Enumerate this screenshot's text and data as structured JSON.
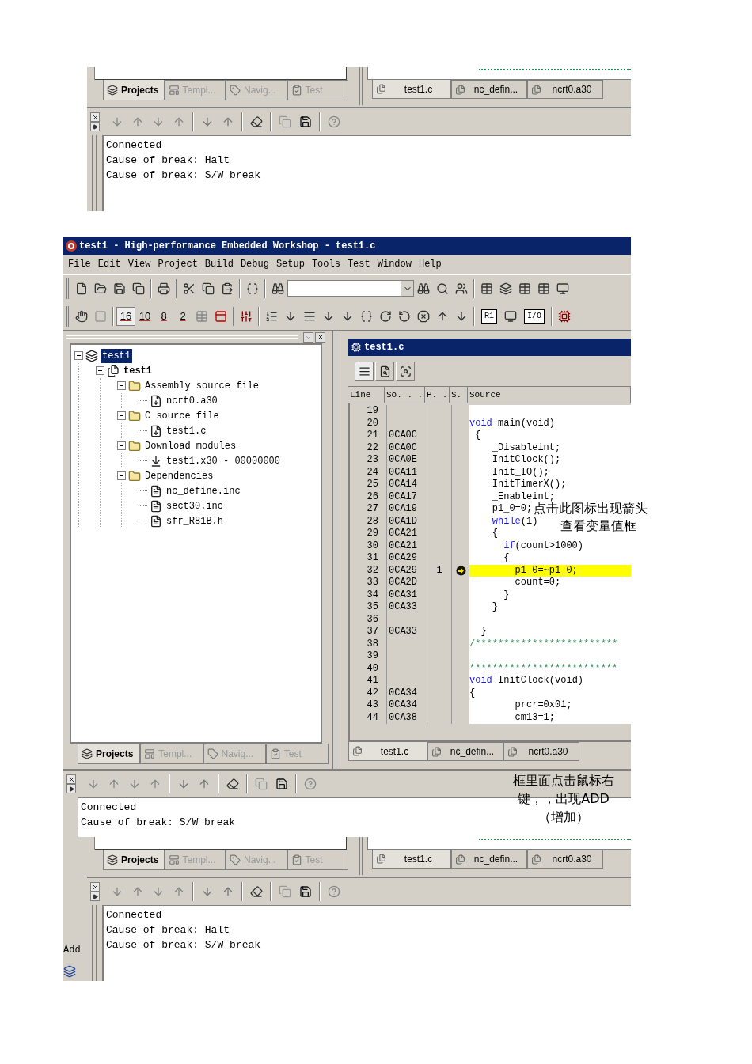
{
  "top_snippet": {
    "panel_tabs": [
      {
        "label": "Projects",
        "kind": "projects",
        "selected": true
      },
      {
        "label": "Templ...",
        "kind": "templates",
        "selected": false
      },
      {
        "label": "Navig...",
        "kind": "navigation",
        "selected": false
      },
      {
        "label": "Test",
        "kind": "test",
        "selected": false
      }
    ],
    "file_tabs": [
      {
        "label": "test1.c",
        "selected": true
      },
      {
        "label": "nc_defin...",
        "selected": false
      },
      {
        "label": "ncrt0.a30",
        "selected": false
      }
    ],
    "log": [
      "Connected",
      "Cause of break: Halt",
      "Cause of break: S/W break"
    ]
  },
  "window": {
    "title": "test1 - High-performance Embedded Workshop - test1.c",
    "menu": [
      "File",
      "Edit",
      "View",
      "Project",
      "Build",
      "Debug",
      "Setup",
      "Tools",
      "Test",
      "Window",
      "Help"
    ],
    "radix_buttons": [
      {
        "label": "16",
        "selected": true
      },
      {
        "label": "10",
        "selected": false
      },
      {
        "label": "8",
        "selected": false
      },
      {
        "label": "2",
        "selected": false
      }
    ],
    "view_buttons": [
      {
        "label": "R1"
      },
      {
        "label": "I/O"
      }
    ],
    "tree": [
      {
        "label": "test1",
        "kind": "workspace",
        "selected": true,
        "expanded": true,
        "children": [
          {
            "label": "test1",
            "kind": "project",
            "selected": false,
            "expanded": true,
            "children": [
              {
                "label": "Assembly source file",
                "kind": "folder",
                "selected": false,
                "expanded": true,
                "children": [
                  {
                    "label": "ncrt0.a30",
                    "kind": "source",
                    "selected": false
                  }
                ]
              },
              {
                "label": "C source file",
                "kind": "folder",
                "selected": false,
                "expanded": true,
                "children": [
                  {
                    "label": "test1.c",
                    "kind": "source",
                    "selected": false
                  }
                ]
              },
              {
                "label": "Download modules",
                "kind": "folder",
                "selected": false,
                "expanded": true,
                "children": [
                  {
                    "label": "test1.x30 - 00000000",
                    "kind": "module",
                    "selected": false
                  }
                ]
              },
              {
                "label": "Dependencies",
                "kind": "folder",
                "selected": false,
                "expanded": true,
                "children": [
                  {
                    "label": "nc_define.inc",
                    "kind": "header",
                    "selected": false
                  },
                  {
                    "label": "sect30.inc",
                    "kind": "header",
                    "selected": false
                  },
                  {
                    "label": "sfr_R81B.h",
                    "kind": "header",
                    "selected": false
                  }
                ]
              }
            ]
          }
        ]
      }
    ],
    "panel_tabs": [
      {
        "label": "Projects",
        "kind": "projects",
        "selected": true
      },
      {
        "label": "Templ...",
        "kind": "templates",
        "selected": false
      },
      {
        "label": "Navig...",
        "kind": "navigation",
        "selected": false
      },
      {
        "label": "Test",
        "kind": "test",
        "selected": false
      }
    ],
    "editor": {
      "title": "test1.c",
      "mode_buttons": [
        {
          "selected": true
        },
        {
          "selected": false
        },
        {
          "selected": false
        }
      ],
      "columns": [
        "Line",
        "So. . .",
        "P. .",
        "S.",
        "Source"
      ],
      "rows": [
        {
          "line": "19",
          "current": false,
          "source": []
        },
        {
          "line": "20",
          "current": false,
          "source": [
            {
              "kind": "keyword",
              "text": "void"
            },
            {
              "kind": "plain",
              "text": " main(void)"
            }
          ]
        },
        {
          "line": "21",
          "address": "0CA0C",
          "current": false,
          "source": [
            {
              "kind": "plain",
              "text": " {"
            }
          ]
        },
        {
          "line": "22",
          "address": "0CA0C",
          "current": false,
          "source": [
            {
              "kind": "plain",
              "text": "    _Disableint;"
            }
          ]
        },
        {
          "line": "23",
          "address": "0CA0E",
          "current": false,
          "source": [
            {
              "kind": "plain",
              "text": "    InitClock();"
            }
          ]
        },
        {
          "line": "24",
          "address": "0CA11",
          "current": false,
          "source": [
            {
              "kind": "plain",
              "text": "    Init_IO();"
            }
          ]
        },
        {
          "line": "25",
          "address": "0CA14",
          "current": false,
          "source": [
            {
              "kind": "plain",
              "text": "    InitTimerX();"
            }
          ]
        },
        {
          "line": "26",
          "address": "0CA17",
          "current": false,
          "source": [
            {
              "kind": "plain",
              "text": "    _Enableint;"
            }
          ]
        },
        {
          "line": "27",
          "address": "0CA19",
          "current": false,
          "source": [
            {
              "kind": "plain",
              "text": "    p1_0=0;"
            }
          ]
        },
        {
          "line": "28",
          "address": "0CA1D",
          "current": false,
          "source": [
            {
              "kind": "keyword",
              "text": "    while"
            },
            {
              "kind": "plain",
              "text": "(1)"
            }
          ]
        },
        {
          "line": "29",
          "address": "0CA21",
          "current": false,
          "source": [
            {
              "kind": "plain",
              "text": "    {"
            }
          ]
        },
        {
          "line": "30",
          "address": "0CA21",
          "current": false,
          "source": [
            {
              "kind": "keyword",
              "text": "      if"
            },
            {
              "kind": "plain",
              "text": "(count>1000)"
            }
          ]
        },
        {
          "line": "31",
          "address": "0CA29",
          "current": false,
          "source": [
            {
              "kind": "plain",
              "text": "      {"
            }
          ]
        },
        {
          "line": "32",
          "address": "0CA29",
          "pass": "1",
          "current": true,
          "source": [
            {
              "kind": "plain",
              "text": "        p1_0=~p1_0;"
            }
          ]
        },
        {
          "line": "33",
          "address": "0CA2D",
          "current": false,
          "source": [
            {
              "kind": "plain",
              "text": "        count=0;"
            }
          ]
        },
        {
          "line": "34",
          "address": "0CA31",
          "current": false,
          "source": [
            {
              "kind": "plain",
              "text": "      }"
            }
          ]
        },
        {
          "line": "35",
          "address": "0CA33",
          "current": false,
          "source": [
            {
              "kind": "plain",
              "text": "    }"
            }
          ]
        },
        {
          "line": "36",
          "current": false,
          "source": []
        },
        {
          "line": "37",
          "address": "0CA33",
          "current": false,
          "source": [
            {
              "kind": "plain",
              "text": "  }"
            }
          ]
        },
        {
          "line": "38",
          "current": false,
          "source": [
            {
              "kind": "comment",
              "text": "/*************************"
            }
          ]
        },
        {
          "line": "39",
          "current": false,
          "source": []
        },
        {
          "line": "40",
          "current": false,
          "source": [
            {
              "kind": "comment",
              "text": "**************************"
            }
          ]
        },
        {
          "line": "41",
          "current": false,
          "source": [
            {
              "kind": "keyword",
              "text": "void"
            },
            {
              "kind": "plain",
              "text": " InitClock(void)"
            }
          ]
        },
        {
          "line": "42",
          "address": "0CA34",
          "current": false,
          "source": [
            {
              "kind": "plain",
              "text": "{"
            }
          ]
        },
        {
          "line": "43",
          "address": "0CA34",
          "current": false,
          "source": [
            {
              "kind": "plain",
              "text": "        prcr=0x01;"
            }
          ]
        },
        {
          "line": "44",
          "address": "0CA38",
          "current": false,
          "source": [
            {
              "kind": "plain",
              "text": "        cm13=1;"
            }
          ]
        }
      ],
      "file_tabs": [
        {
          "label": "test1.c",
          "selected": true
        },
        {
          "label": "nc_defin...",
          "selected": false
        },
        {
          "label": "ncrt0.a30",
          "selected": false
        }
      ]
    },
    "output": {
      "log": [
        "Connected",
        "Cause of break: S/W break"
      ]
    }
  },
  "annotations": [
    {
      "lines": [
        "点击此图标出现箭头",
        "查看变量值框"
      ]
    },
    {
      "lines": [
        "框里面点击鼠标右",
        "键，，出现ADD",
        "（增加）"
      ]
    }
  ],
  "pasted_snippet": {
    "side_text": "Add",
    "panel_tabs": [
      {
        "label": "Projects",
        "kind": "projects",
        "selected": true
      },
      {
        "label": "Templ...",
        "kind": "templates",
        "selected": false
      },
      {
        "label": "Navig...",
        "kind": "navigation",
        "selected": false
      },
      {
        "label": "Test",
        "kind": "test",
        "selected": false
      }
    ],
    "file_tabs": [
      {
        "label": "test1.c",
        "selected": true
      },
      {
        "label": "nc_defin...",
        "selected": false
      },
      {
        "label": "ncrt0.a30",
        "selected": false
      }
    ],
    "log": [
      "Connected",
      "Cause of break: Halt",
      "Cause of break: S/W break"
    ]
  }
}
